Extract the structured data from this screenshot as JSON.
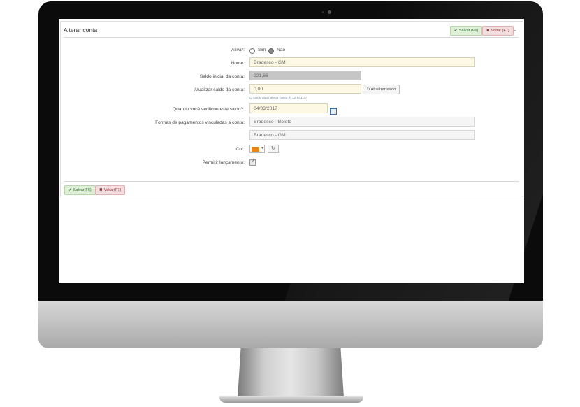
{
  "header": {
    "title": "Alterar conta",
    "save_label": "Salvar (F6)",
    "back_label": "Voltar (F7)",
    "more": "..."
  },
  "form": {
    "ativa": {
      "label": "Ativa*:",
      "options": [
        "Sim",
        "Não"
      ],
      "selected": "Não"
    },
    "nome": {
      "label": "Nome:",
      "value": "Bradesco - GM"
    },
    "saldo_inicial": {
      "label": "Saldo inicial da conta:",
      "value": "221,66"
    },
    "atualizar_saldo": {
      "label": "Atualizar saldo da conta:",
      "value": "0,00",
      "button": "Atualizar saldo",
      "hint": "O saldo atual desta conta é: 12.831,37"
    },
    "verificado": {
      "label": "Quando você verificou este saldo?:",
      "value": "04/03/2017"
    },
    "formas_pagamento": {
      "label": "Formas de pagamentos vinculadas a conta:",
      "items": [
        "Bradesco - Boleto",
        "Bradesco - GM"
      ]
    },
    "cor": {
      "label": "Cor:",
      "value": "#e8861a"
    },
    "permitir": {
      "label": "Permitir lançamento:",
      "checked": true
    }
  },
  "footer": {
    "save_label": "Salvar(F6)",
    "back_label": "Voltar(F7)"
  },
  "icons": {
    "check": "check-icon",
    "close": "close-icon",
    "refresh": "refresh-icon",
    "calendar": "calendar-icon",
    "more": "more-icon"
  }
}
